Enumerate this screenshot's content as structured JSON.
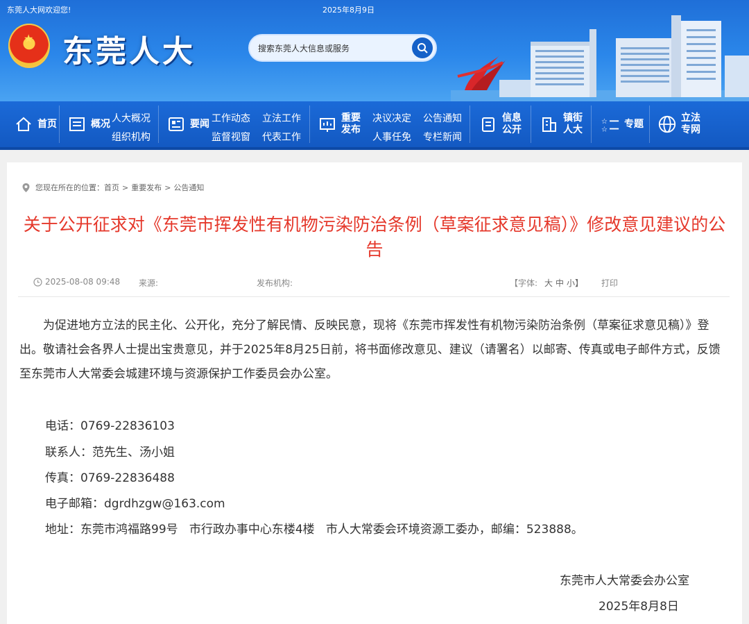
{
  "header": {
    "welcome": "东莞人大网欢迎您!",
    "date": "2025年8月9日",
    "site_title": "东莞人大",
    "search_placeholder": "搜索东莞人大信息或服务"
  },
  "nav": {
    "home": "首页",
    "overview": "概况",
    "overview_sub1": "人大概况",
    "overview_sub2": "组织机构",
    "news": "要闻",
    "news_sub1": "工作动态",
    "news_sub2": "立法工作",
    "news_sub3": "监督视窗",
    "news_sub4": "代表工作",
    "release": "重要发布",
    "release_sub1": "决议决定",
    "release_sub2": "公告通知",
    "release_sub3": "人事任免",
    "release_sub4": "专栏新闻",
    "info": "信息公开",
    "town": "镇街人大",
    "topic": "专题",
    "legislation": "立法专网"
  },
  "breadcrumb": {
    "prefix": "您现在所在的位置：",
    "home": "首页",
    "sep": ">",
    "release": "重要发布",
    "notice": "公告通知"
  },
  "article": {
    "title": "关于公开征求对《东莞市挥发性有机物污染防治条例（草案征求意见稿）》修改意见建议的公告",
    "datetime": "2025-08-08 09:48",
    "source_label": "来源:",
    "org_label": "发布机构:",
    "font_label": "【字体:",
    "font_large": "大",
    "font_medium": "中",
    "font_small": "小】",
    "print": "打印",
    "body": "为促进地方立法的民主化、公开化，充分了解民情、反映民意，现将《东莞市挥发性有机物污染防治条例（草案征求意见稿）》登出。敬请社会各界人士提出宝贵意见，并于2025年8月25日前，将书面修改意见、建议（请署名）以邮寄、传真或电子邮件方式，反馈至东莞市人大常委会城建环境与资源保护工作委员会办公室。",
    "phone": "电话：0769-22836103",
    "contacts": "联系人：范先生、汤小姐",
    "fax": "传真：0769-22836488",
    "email": "电子邮箱：dgrdhzgw@163.com",
    "address": "地址：东莞市鸿福路99号   市行政办事中心东楼4楼   市人大常委会环境资源工委办，邮编：523888。",
    "signer": "东莞市人大常委会办公室",
    "sign_date": "2025年8月8日"
  },
  "colors": {
    "brand_blue": "#1b6ad8",
    "title_red": "#e5382b"
  }
}
